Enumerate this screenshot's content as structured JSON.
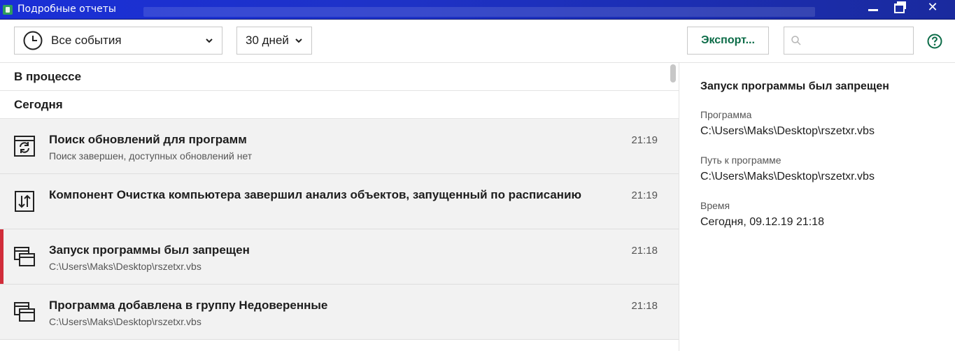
{
  "window": {
    "title": "Подробные отчеты",
    "controls": {
      "minimize": "minimize",
      "maximize": "maximize",
      "close": "✕"
    }
  },
  "toolbar": {
    "events_filter": {
      "selected": "Все события",
      "icon": "clock-icon"
    },
    "period_filter": {
      "selected": "30 дней"
    },
    "export_label": "Экспорт...",
    "search": {
      "placeholder": "",
      "value": "",
      "icon": "search-icon"
    },
    "help_icon": "help-icon"
  },
  "sections": {
    "in_progress": "В процессе",
    "today": "Сегодня"
  },
  "events": [
    {
      "icon": "update-refresh-icon",
      "title": "Поиск обновлений для программ",
      "subtitle": "Поиск завершен, доступных обновлений нет",
      "time": "21:19"
    },
    {
      "icon": "scan-sliders-icon",
      "title": "Компонент Очистка компьютера завершил анализ объектов, запущенный по расписанию",
      "subtitle": "",
      "time": "21:19"
    },
    {
      "icon": "application-windows-icon",
      "title": "Запуск программы был запрещен",
      "subtitle": "C:\\Users\\Maks\\Desktop\\rszetxr.vbs",
      "time": "21:18",
      "selected": true
    },
    {
      "icon": "application-windows-icon",
      "title": "Программа добавлена в группу Недоверенные",
      "subtitle": "C:\\Users\\Maks\\Desktop\\rszetxr.vbs",
      "time": "21:18"
    }
  ],
  "details": {
    "title": "Запуск программы был запрещен",
    "program_label": "Программа",
    "program_value": "C:\\Users\\Maks\\Desktop\\rszetxr.vbs",
    "path_label": "Путь к программе",
    "path_value": "C:\\Users\\Maks\\Desktop\\rszetxr.vbs",
    "time_label": "Время",
    "time_value": "Сегодня, 09.12.19 21:18"
  },
  "colors": {
    "accent_green": "#0b6b47",
    "selected_marker": "#d12d3a",
    "titlebar_blue": "#1a2fd6"
  }
}
